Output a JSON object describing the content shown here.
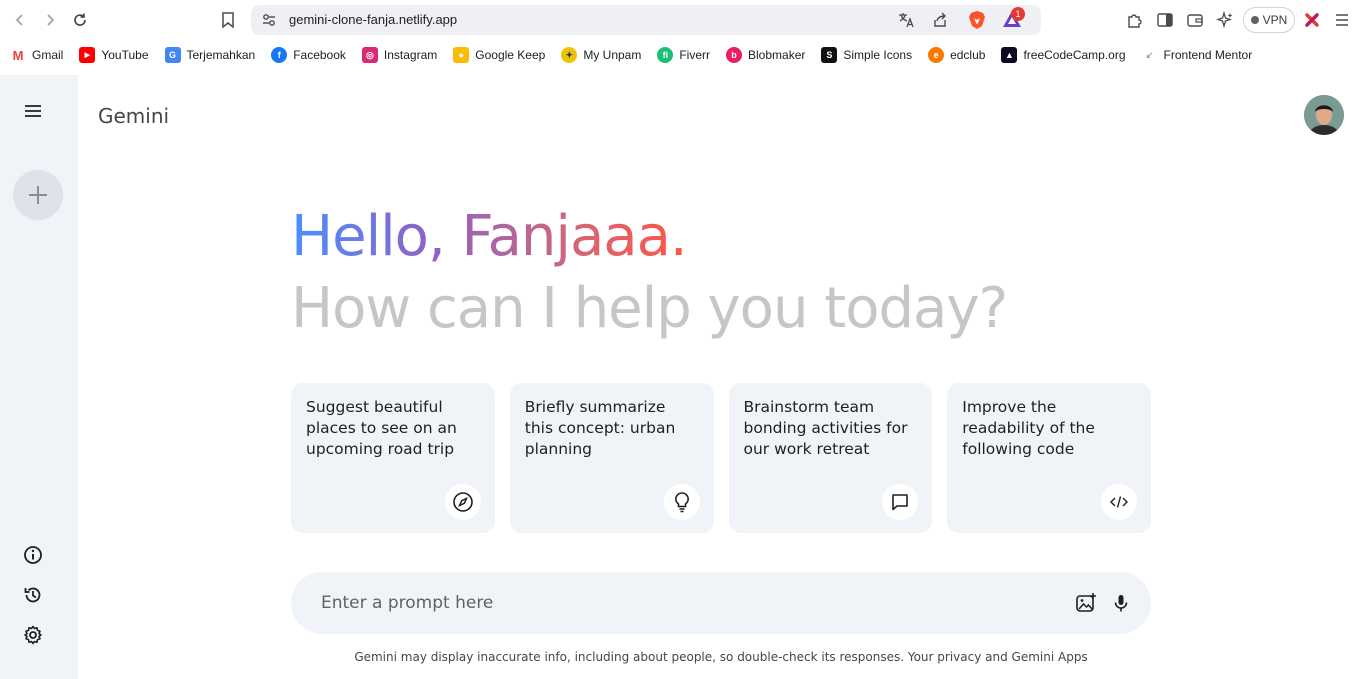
{
  "browser": {
    "url": "gemini-clone-fanja.netlify.app",
    "vpn_label": "VPN",
    "notification_count": "1",
    "bookmarks": [
      {
        "label": "Gmail",
        "color": "#ea4335",
        "icon": "gmail-icon"
      },
      {
        "label": "YouTube",
        "color": "#ff0000",
        "icon": "youtube-icon"
      },
      {
        "label": "Terjemahkan",
        "color": "#4285f4",
        "icon": "translate-icon"
      },
      {
        "label": "Facebook",
        "color": "#1877f2",
        "icon": "facebook-icon"
      },
      {
        "label": "Instagram",
        "color": "#d62976",
        "icon": "instagram-icon"
      },
      {
        "label": "Google Keep",
        "color": "#fbbc04",
        "icon": "keep-icon"
      },
      {
        "label": "My Unpam",
        "color": "#f2c200",
        "icon": "unpam-icon"
      },
      {
        "label": "Fiverr",
        "color": "#1dbf73",
        "icon": "fiverr-icon"
      },
      {
        "label": "Blobmaker",
        "color": "#e91e63",
        "icon": "blobmaker-icon"
      },
      {
        "label": "Simple Icons",
        "color": "#111111",
        "icon": "simpleicons-icon"
      },
      {
        "label": "edclub",
        "color": "#f57c00",
        "icon": "edclub-icon"
      },
      {
        "label": "freeCodeCamp.org",
        "color": "#0a0a23",
        "icon": "freecodecamp-icon"
      },
      {
        "label": "Frontend Mentor",
        "color": "#9aa0a6",
        "icon": "frontendmentor-icon"
      }
    ]
  },
  "app": {
    "title": "Gemini",
    "greeting": "Hello, Fanjaaa.",
    "subtitle": "How can I help you today?",
    "cards": [
      {
        "text": "Suggest beautiful places to see on an upcoming road trip",
        "icon": "compass-icon"
      },
      {
        "text": "Briefly summarize this concept: urban planning",
        "icon": "bulb-icon"
      },
      {
        "text": "Brainstorm team bonding activities for our work retreat",
        "icon": "message-icon"
      },
      {
        "text": "Improve the readability of the following code",
        "icon": "code-icon"
      }
    ],
    "prompt_placeholder": "Enter a prompt here",
    "disclaimer": "Gemini may display inaccurate info, including about people, so double-check its responses. Your privacy and Gemini Apps"
  },
  "colors": {
    "sidebar_bg": "#f0f4f9",
    "card_bg": "#f0f4f9",
    "gradient_start": "#4b90ff",
    "gradient_end": "#ff5546",
    "subtitle_color": "#c4c7c5"
  }
}
